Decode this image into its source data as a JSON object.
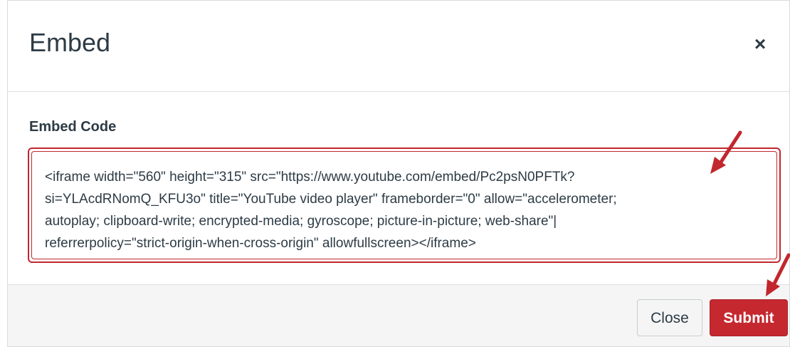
{
  "dialog": {
    "title": "Embed",
    "close_glyph": "×"
  },
  "form": {
    "embed_code_label": "Embed Code",
    "embed_code_value": "<iframe width=\"560\" height=\"315\" src=\"https://www.youtube.com/embed/Pc2psN0PFTk?\nsi=YLAcdRNomQ_KFU3o\" title=\"YouTube video player\" frameborder=\"0\" allow=\"accelerometer;\nautoplay; clipboard-write; encrypted-media; gyroscope; picture-in-picture; web-share\"|\nreferrerpolicy=\"strict-origin-when-cross-origin\" allowfullscreen></iframe>"
  },
  "footer": {
    "close_label": "Close",
    "submit_label": "Submit"
  },
  "colors": {
    "accent_red": "#c5282f",
    "annotation_arrow": "#c1272d",
    "text_dark": "#2d3b45"
  },
  "icons": {
    "close": "close-icon",
    "annotation_arrows": [
      "red-arrow-icon",
      "red-arrow-icon"
    ]
  }
}
